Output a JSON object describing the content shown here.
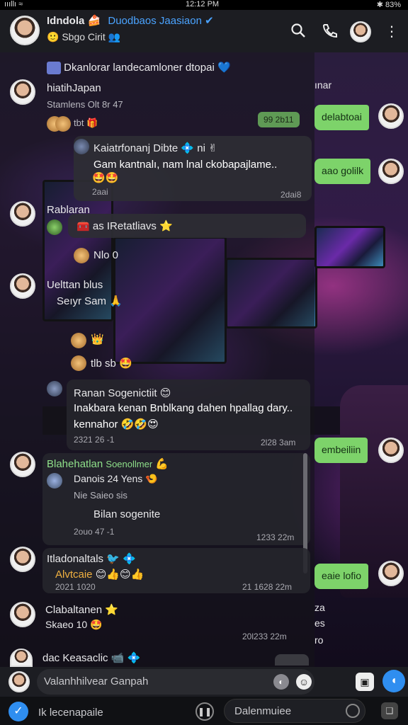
{
  "status": {
    "left": "ıııllı ≈",
    "time": "12:12 PM",
    "right": "✱ 83%"
  },
  "header": {
    "title": "Idndola",
    "title_emoji": "🍰",
    "title_tag": "Duodbaos Jaasiaon",
    "verified": "✔",
    "subtitle_emoji": "🙂",
    "subtitle": "Sbgo Cirit",
    "subtitle_icon": "👥",
    "icons": [
      "search-icon",
      "phone-icon",
      "profile-avatar",
      "more-vertical-icon"
    ]
  },
  "messages": [
    {
      "id": "m1",
      "name": "Dkanlorar landecamloner dtopai",
      "badge": "💙",
      "sub": "hiatihJapan",
      "meta": "Stamlens Olt 8r 47",
      "reaction": "tbt 🎁"
    },
    {
      "id": "m2",
      "name": "Kaiatrfonanj Dibte",
      "badge": "💠 ni ✌",
      "text": "Gam kantnalı, nam lnal ckobapajlame..",
      "emoji": "🤩🤩",
      "time_left": "2aai",
      "time_right": "2dai8"
    },
    {
      "id": "m3",
      "name": "Rablaran",
      "event": "as IRetatliavs",
      "event_icon": "🧰",
      "event_emoji": "⭐",
      "sub": "Nlo 0",
      "sub2": "Uelttan blus",
      "sub3": "Seıyr Sam",
      "sub3_emoji": "🙏",
      "sub4": "tlb sb",
      "sub4_emoji": "🤩"
    },
    {
      "id": "m4",
      "name": "Ranan Sogenictiit",
      "name_emoji": "😊",
      "text1": "Inakbara kenan Bnblkang dahen hpallag dary..",
      "text2": "kennahor",
      "emoji": "🤣🤣😍",
      "time_left": "2321 26 -1",
      "time_right": "2l28 3am"
    },
    {
      "id": "m5",
      "name": "Blahehatlan",
      "name_tag": "Soenollmer",
      "name_emoji": "💪",
      "line1": "Danois 24 Yens",
      "line1_emoji": "🍤",
      "line2": "Nie Saieo sis",
      "line3": "Bilan sogenite",
      "time_left": "2ouo 47 -1",
      "time_right": "1233 22m"
    },
    {
      "id": "m6",
      "name": "Itladonaltals",
      "badge": "🐦 💠",
      "text": "Alvtcaie",
      "emoji": "😊👍😊👍",
      "time_left": "2021 1020",
      "time_right": "21 1628 22m"
    },
    {
      "id": "m7",
      "name": "Clabaltanen",
      "badge": "⭐",
      "text": "Skaeo 10",
      "emoji": "🤩",
      "time_right": "20l233 22m"
    },
    {
      "id": "m8",
      "name": "dac Keasaclic",
      "badge": "📹 💠"
    }
  ],
  "right_side": {
    "top_label": "ınar",
    "green1": "delabtoai",
    "small_green": "99 2b11",
    "green2": "aao golilk",
    "green3": "embeiliin",
    "green4": "eaie lofio",
    "labels": [
      "za",
      "es",
      "ro"
    ]
  },
  "input": {
    "placeholder": "Valanhhilvear Ganpah",
    "icons": [
      "sticker-icon",
      "emoji-icon",
      "camera-icon",
      "send-icon"
    ]
  },
  "bottom": {
    "left_label": "Ik lecenapaile",
    "right_label": "Dalenmuiee"
  },
  "colors": {
    "accent": "#4aa3ff",
    "bubble_out": "#7dd36a",
    "header_bg": "#1c1d22"
  }
}
